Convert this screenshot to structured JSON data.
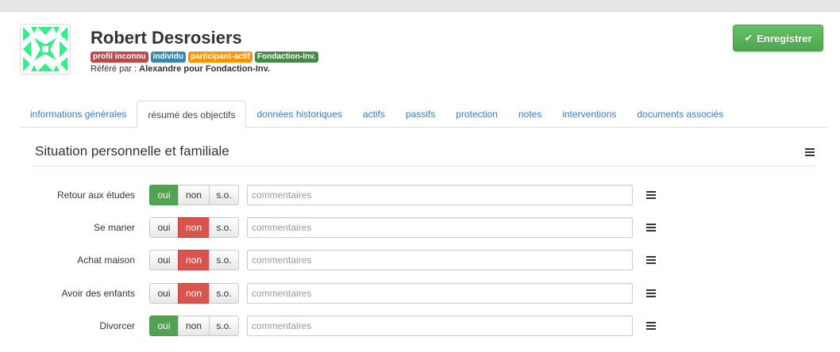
{
  "profile": {
    "name": "Robert Desrosiers",
    "badges": [
      {
        "label": "profil inconnu",
        "color": "#b94a48"
      },
      {
        "label": "individu",
        "color": "#3a87ad"
      },
      {
        "label": "participant-actif",
        "color": "#f89406"
      },
      {
        "label": "Fondaction-Inv.",
        "color": "#468847"
      }
    ],
    "referred_prefix": "Référé par : ",
    "referred_by": "Alexandre pour Fondaction-Inv."
  },
  "toolbar": {
    "save_label": "Enregistrer",
    "save_icon": "check-icon",
    "save_color": "#5bb75b"
  },
  "tabs": [
    {
      "label": "informations générales",
      "active": false
    },
    {
      "label": "résumé des objectifs",
      "active": true
    },
    {
      "label": "données historiques",
      "active": false
    },
    {
      "label": "actifs",
      "active": false
    },
    {
      "label": "passifs",
      "active": false
    },
    {
      "label": "protection",
      "active": false
    },
    {
      "label": "notes",
      "active": false
    },
    {
      "label": "interventions",
      "active": false
    },
    {
      "label": "documents associés",
      "active": false
    }
  ],
  "section": {
    "title": "Situation personnelle et familiale",
    "menu_icon": "menu-icon"
  },
  "options": {
    "yes": "oui",
    "no": "non",
    "na": "s.o."
  },
  "colors": {
    "yes_active": "#51a351",
    "no_active": "#d9534f",
    "link": "#3a7bbf"
  },
  "objectives": [
    {
      "label": "Retour aux études",
      "selected": "oui",
      "comment": "",
      "placeholder": "commentaires"
    },
    {
      "label": "Se marier",
      "selected": "non",
      "comment": "",
      "placeholder": "commentaires"
    },
    {
      "label": "Achat maison",
      "selected": "non",
      "comment": "",
      "placeholder": "commentaires"
    },
    {
      "label": "Avoir des enfants",
      "selected": "non",
      "comment": "",
      "placeholder": "commentaires"
    },
    {
      "label": "Divorcer",
      "selected": "oui",
      "comment": "",
      "placeholder": "commentaires"
    }
  ]
}
